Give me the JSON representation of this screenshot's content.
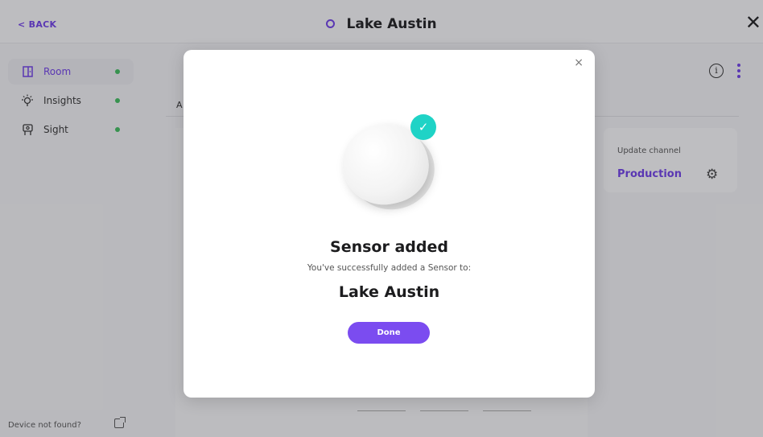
{
  "header": {
    "back_label": "< BACK",
    "title": "Lake Austin",
    "close_glyph": "✕"
  },
  "sidebar": {
    "items": [
      {
        "label": "Room",
        "icon": "door-icon",
        "status": "online"
      },
      {
        "label": "Insights",
        "icon": "lightbulb-icon",
        "status": "online"
      },
      {
        "label": "Sight",
        "icon": "camera-icon",
        "status": "online"
      }
    ],
    "footer_label": "Device not found?"
  },
  "main": {
    "tab_fragment": "A",
    "update_channel": {
      "label": "Update channel",
      "value": "Production"
    }
  },
  "modal": {
    "close_glyph": "×",
    "title": "Sensor added",
    "subtitle": "You've successfully added a Sensor to:",
    "place": "Lake Austin",
    "done_label": "Done"
  },
  "colors": {
    "accent": "#6e3ee6",
    "button": "#7b4cf0",
    "check": "#1fd3c6",
    "status_dot": "#3dbb5c"
  }
}
